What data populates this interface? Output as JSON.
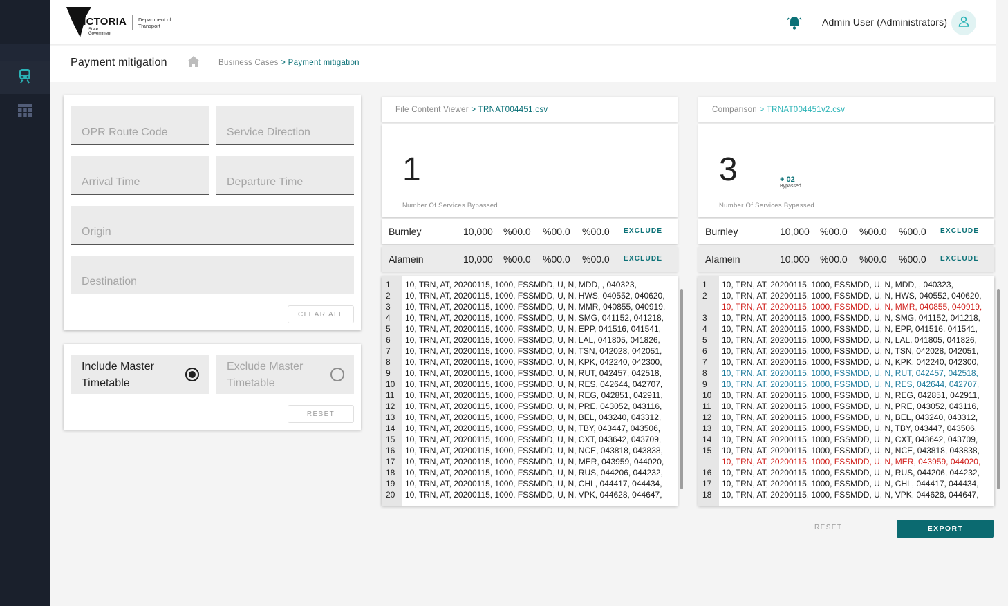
{
  "sidebar": {
    "items": [
      {
        "icon": "train-icon",
        "active": true,
        "color": "#2ab3b6"
      },
      {
        "icon": "table-icon",
        "active": false,
        "color": "#525d78"
      }
    ]
  },
  "header": {
    "logo_main": "VICTORIA",
    "logo_sub": "State Government",
    "logo_dept": "Department of Transport",
    "user_name": "Admin User (Administrators)",
    "bell_color": "#0b7177"
  },
  "subheader": {
    "title": "Payment mitigation",
    "breadcrumb_root": "Business Cases",
    "breadcrumb_sep": " > ",
    "breadcrumb_current": "Payment mitigation"
  },
  "filters": {
    "opr_route_code": {
      "placeholder": "OPR Route Code",
      "value": ""
    },
    "service_direction": {
      "placeholder": "Service Direction",
      "value": ""
    },
    "arrival_time": {
      "placeholder": "Arrival Time",
      "value": ""
    },
    "departure_time": {
      "placeholder": "Departure Time",
      "value": ""
    },
    "origin": {
      "placeholder": "Origin",
      "value": ""
    },
    "destination": {
      "placeholder": "Destination",
      "value": ""
    },
    "clear_all_label": "CLEAR ALL"
  },
  "timetable": {
    "include_label": "Include Master Timetable",
    "exclude_label": "Exclude Master Timetable",
    "selected": "include",
    "reset_label": "RESET"
  },
  "left_panel": {
    "root": "File Content Viewer",
    "sep": " > ",
    "file": "TRNAT004451.csv",
    "count": "1",
    "count_label": "Number Of Services Bypassed",
    "rows": [
      {
        "name": "Burnley",
        "value": "10,000",
        "p1": "%00.0",
        "p2": "%00.0",
        "p3": "%00.0",
        "action": "EXCLUDE"
      },
      {
        "name": "Alamein",
        "value": "10,000",
        "p1": "%00.0",
        "p2": "%00.0",
        "p3": "%00.0",
        "action": "EXCLUDE"
      }
    ],
    "lines": [
      {
        "n": "1",
        "t": "10, TRN, AT, 20200115, 1000, FSSMDD, U, N, MDD, , 040323,"
      },
      {
        "n": "2",
        "t": "10, TRN, AT, 20200115, 1000, FSSMDD, U, N, HWS, 040552, 040620,"
      },
      {
        "n": "3",
        "t": "10, TRN, AT, 20200115, 1000, FSSMDD, U, N, MMR, 040855, 040919,"
      },
      {
        "n": "4",
        "t": "10, TRN, AT, 20200115, 1000, FSSMDD, U, N, SMG, 041152, 041218,"
      },
      {
        "n": "5",
        "t": "10, TRN, AT, 20200115, 1000, FSSMDD, U, N, EPP, 041516, 041541,"
      },
      {
        "n": "6",
        "t": "10, TRN, AT, 20200115, 1000, FSSMDD, U, N, LAL, 041805, 041826,"
      },
      {
        "n": "7",
        "t": "10, TRN, AT, 20200115, 1000, FSSMDD, U, N, TSN, 042028, 042051,"
      },
      {
        "n": "8",
        "t": "10, TRN, AT, 20200115, 1000, FSSMDD, U, N, KPK, 042240, 042300,"
      },
      {
        "n": "9",
        "t": "10, TRN, AT, 20200115, 1000, FSSMDD, U, N, RUT, 042457, 042518,"
      },
      {
        "n": "10",
        "t": "10, TRN, AT, 20200115, 1000, FSSMDD, U, N, RES, 042644, 042707,"
      },
      {
        "n": "11",
        "t": "10, TRN, AT, 20200115, 1000, FSSMDD, U, N, REG, 042851, 042911,"
      },
      {
        "n": "12",
        "t": "10, TRN, AT, 20200115, 1000, FSSMDD, U, N, PRE, 043052, 043116,"
      },
      {
        "n": "13",
        "t": "10, TRN, AT, 20200115, 1000, FSSMDD, U, N, BEL, 043240, 043312,"
      },
      {
        "n": "14",
        "t": "10, TRN, AT, 20200115, 1000, FSSMDD, U, N, TBY, 043447, 043506,"
      },
      {
        "n": "15",
        "t": "10, TRN, AT, 20200115, 1000, FSSMDD, U, N, CXT, 043642, 043709,"
      },
      {
        "n": "16",
        "t": "10, TRN, AT, 20200115, 1000, FSSMDD, U, N, NCE, 043818, 043838,"
      },
      {
        "n": "17",
        "t": "10, TRN, AT, 20200115, 1000, FSSMDD, U, N, MER, 043959, 044020,"
      },
      {
        "n": "18",
        "t": "10, TRN, AT, 20200115, 1000, FSSMDD, U, N, RUS, 044206, 044232,"
      },
      {
        "n": "19",
        "t": "10, TRN, AT, 20200115, 1000, FSSMDD, U, N, CHL, 044417, 044434,"
      },
      {
        "n": "20",
        "t": "10, TRN, AT, 20200115, 1000, FSSMDD, U, N, VPK, 044628, 044647,"
      }
    ]
  },
  "right_panel": {
    "root": "Comparison",
    "sep": " > ",
    "file": "TRNAT004451v2.csv",
    "count": "3",
    "delta": "+ 02",
    "delta_label": "Bypassed",
    "count_label": "Number Of Services Bypassed",
    "rows": [
      {
        "name": "Burnley",
        "value": "10,000",
        "p1": "%00.0",
        "p2": "%00.0",
        "p3": "%00.0",
        "action": "EXCLUDE"
      },
      {
        "name": "Alamein",
        "value": "10,000",
        "p1": "%00.0",
        "p2": "%00.0",
        "p3": "%00.0",
        "action": "EXCLUDE"
      }
    ],
    "lines": [
      {
        "n": "1",
        "t": "10, TRN, AT, 20200115, 1000, FSSMDD, U, N, MDD, , 040323,",
        "s": ""
      },
      {
        "n": "2",
        "t": "10, TRN, AT, 20200115, 1000, FSSMDD, U, N, HWS, 040552, 040620,",
        "s": ""
      },
      {
        "n": "",
        "t": "10, TRN, AT, 20200115, 1000, FSSMDD, U, N, MMR, 040855, 040919,",
        "s": "red"
      },
      {
        "n": "3",
        "t": "10, TRN, AT, 20200115, 1000, FSSMDD, U, N, SMG, 041152, 041218,",
        "s": ""
      },
      {
        "n": "4",
        "t": "10, TRN, AT, 20200115, 1000, FSSMDD, U, N, EPP, 041516, 041541,",
        "s": ""
      },
      {
        "n": "5",
        "t": "10, TRN, AT, 20200115, 1000, FSSMDD, U, N, LAL, 041805, 041826,",
        "s": ""
      },
      {
        "n": "6",
        "t": "10, TRN, AT, 20200115, 1000, FSSMDD, U, N, TSN, 042028, 042051,",
        "s": ""
      },
      {
        "n": "7",
        "t": "10, TRN, AT, 20200115, 1000, FSSMDD, U, N, KPK, 042240, 042300,",
        "s": ""
      },
      {
        "n": "8",
        "t": "10, TRN, AT, 20200115, 1000, FSSMDD, U, N, RUT, 042457, 042518,",
        "s": "blue"
      },
      {
        "n": "9",
        "t": "10, TRN, AT, 20200115, 1000, FSSMDD, U, N, RES, 042644, 042707,",
        "s": "blue"
      },
      {
        "n": "10",
        "t": "10, TRN, AT, 20200115, 1000, FSSMDD, U, N, REG, 042851, 042911,",
        "s": ""
      },
      {
        "n": "11",
        "t": "10, TRN, AT, 20200115, 1000, FSSMDD, U, N, PRE, 043052, 043116,",
        "s": ""
      },
      {
        "n": "12",
        "t": "10, TRN, AT, 20200115, 1000, FSSMDD, U, N, BEL, 043240, 043312,",
        "s": ""
      },
      {
        "n": "13",
        "t": "10, TRN, AT, 20200115, 1000, FSSMDD, U, N, TBY, 043447, 043506,",
        "s": ""
      },
      {
        "n": "14",
        "t": "10, TRN, AT, 20200115, 1000, FSSMDD, U, N, CXT, 043642, 043709,",
        "s": ""
      },
      {
        "n": "15",
        "t": "10, TRN, AT, 20200115, 1000, FSSMDD, U, N, NCE, 043818, 043838,",
        "s": ""
      },
      {
        "n": "",
        "t": "10, TRN, AT, 20200115, 1000, FSSMDD, U, N, MER, 043959, 044020,",
        "s": "red"
      },
      {
        "n": "16",
        "t": "10, TRN, AT, 20200115, 1000, FSSMDD, U, N, RUS, 044206, 044232,",
        "s": ""
      },
      {
        "n": "17",
        "t": "10, TRN, AT, 20200115, 1000, FSSMDD, U, N, CHL, 044417, 044434,",
        "s": ""
      },
      {
        "n": "18",
        "t": "10, TRN, AT, 20200115, 1000, FSSMDD, U, N, VPK, 044628, 044647,",
        "s": ""
      }
    ]
  },
  "footer": {
    "reset_label": "RESET",
    "export_label": "EXPORT"
  },
  "colors": {
    "accent": "#0b7177",
    "sidebar": "#1a202c",
    "diff_removed": "#d0201c",
    "diff_changed": "#1c7a9b"
  }
}
